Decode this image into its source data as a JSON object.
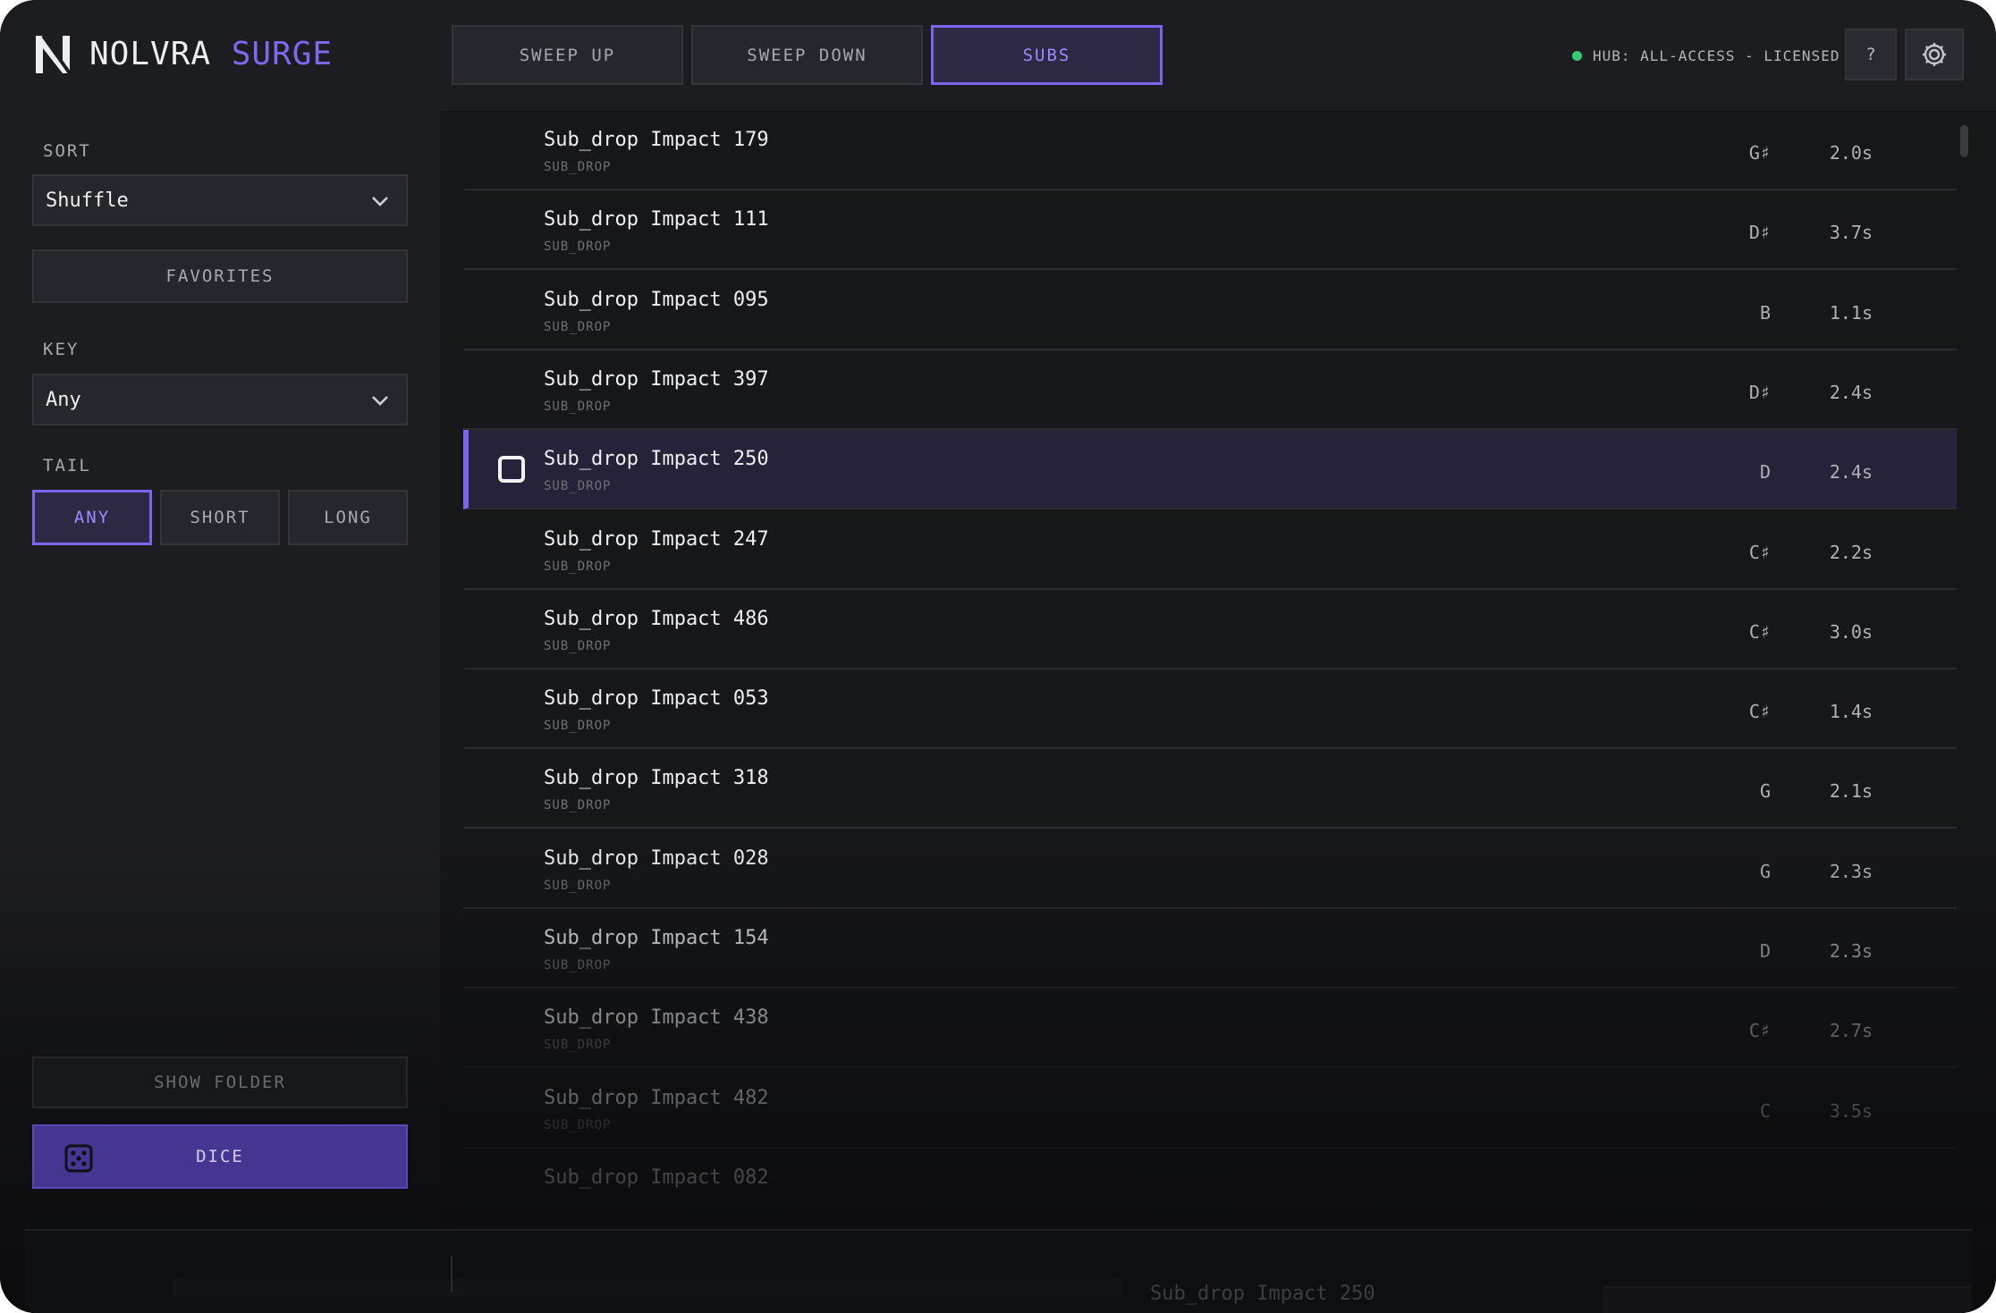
{
  "app": {
    "brand_part1": "NOLVRA",
    "brand_part2": "SURGE"
  },
  "tabs": [
    {
      "label": "SWEEP UP"
    },
    {
      "label": "SWEEP DOWN"
    },
    {
      "label": "SUBS",
      "active": true
    }
  ],
  "header": {
    "hub_status": "HUB: ALL-ACCESS - LICENSED",
    "help_label": "?"
  },
  "sidebar": {
    "sort_label": "SORT",
    "sort_value": "Shuffle",
    "favorites_label": "FAVORITES",
    "key_label": "KEY",
    "key_value": "Any",
    "tail_label": "TAIL",
    "tail_options": [
      "ANY",
      "SHORT",
      "LONG"
    ],
    "tail_selected": "ANY",
    "show_folder_label": "SHOW FOLDER",
    "dice_label": "DICE"
  },
  "list": {
    "items": [
      {
        "name": "Sub_drop Impact 179",
        "category": "SUB_DROP",
        "key": "G♯",
        "duration": "2.0s"
      },
      {
        "name": "Sub_drop Impact 111",
        "category": "SUB_DROP",
        "key": "D♯",
        "duration": "3.7s"
      },
      {
        "name": "Sub_drop Impact 095",
        "category": "SUB_DROP",
        "key": "B",
        "duration": "1.1s"
      },
      {
        "name": "Sub_drop Impact 397",
        "category": "SUB_DROP",
        "key": "D♯",
        "duration": "2.4s"
      },
      {
        "name": "Sub_drop Impact 250",
        "category": "SUB_DROP",
        "key": "D",
        "duration": "2.4s",
        "selected": true
      },
      {
        "name": "Sub_drop Impact 247",
        "category": "SUB_DROP",
        "key": "C♯",
        "duration": "2.2s"
      },
      {
        "name": "Sub_drop Impact 486",
        "category": "SUB_DROP",
        "key": "C♯",
        "duration": "3.0s"
      },
      {
        "name": "Sub_drop Impact 053",
        "category": "SUB_DROP",
        "key": "C♯",
        "duration": "1.4s"
      },
      {
        "name": "Sub_drop Impact 318",
        "category": "SUB_DROP",
        "key": "G",
        "duration": "2.1s"
      },
      {
        "name": "Sub_drop Impact 028",
        "category": "SUB_DROP",
        "key": "G",
        "duration": "2.3s"
      },
      {
        "name": "Sub_drop Impact 154",
        "category": "SUB_DROP",
        "key": "D",
        "duration": "2.3s"
      },
      {
        "name": "Sub_drop Impact 438",
        "category": "SUB_DROP",
        "key": "C♯",
        "duration": "2.7s"
      },
      {
        "name": "Sub_drop Impact 482",
        "category": "SUB_DROP",
        "key": "C",
        "duration": "3.5s"
      },
      {
        "name": "Sub_drop Impact 082",
        "category": "",
        "key": "",
        "duration": ""
      }
    ]
  },
  "transport": {
    "now_playing": "Sub_drop Impact 250"
  },
  "colors": {
    "accent": "#7b65ec",
    "status_ok": "#39c878",
    "background": "#1c1d21",
    "list_background": "#161719"
  }
}
